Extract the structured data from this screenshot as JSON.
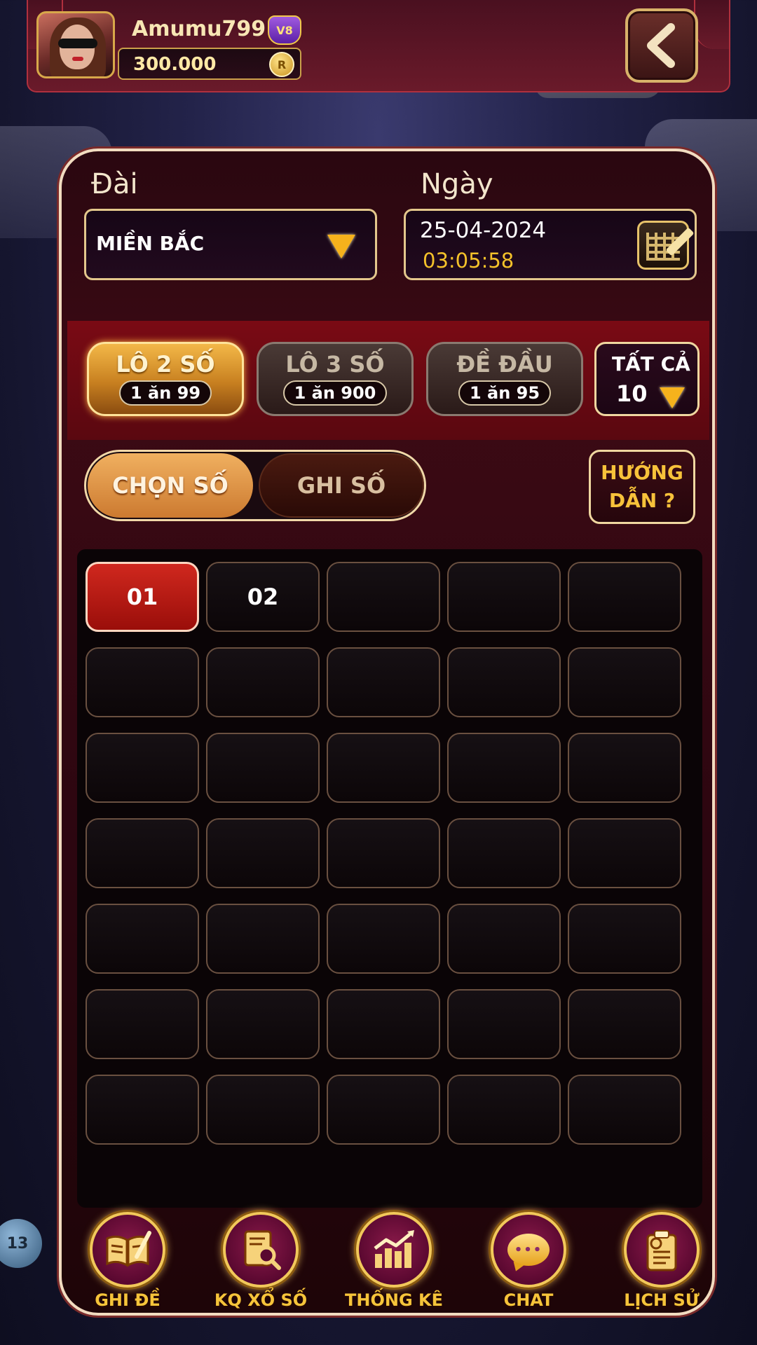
{
  "user": {
    "name": "Amumu799",
    "vip": "V8",
    "balance": "300.000",
    "coin_icon": "R"
  },
  "labels": {
    "station": "Đài",
    "date": "Ngày"
  },
  "station_select": {
    "value": "MIỀN BẮC"
  },
  "date_box": {
    "date": "25-04-2024",
    "time": "03:05:58"
  },
  "bet_types": [
    {
      "name": "LÔ 2 SỐ",
      "rate": "1 ăn 99",
      "active": true
    },
    {
      "name": "LÔ 3 SỐ",
      "rate": "1 ăn 900",
      "active": false
    },
    {
      "name": "ĐỀ ĐẦU",
      "rate": "1 ăn 95",
      "active": false
    }
  ],
  "all_filter": {
    "label": "TẤT CẢ",
    "value": "10"
  },
  "mode_toggle": {
    "choose": "CHỌN SỐ",
    "write": "GHI SỐ",
    "active": "CHỌN SỐ"
  },
  "guide": {
    "line1": "HƯỚNG",
    "line2": "DẪN ?"
  },
  "grid": {
    "rows": 7,
    "cols": 5,
    "cells": [
      "01",
      "02"
    ],
    "selected": "01"
  },
  "bottom_nav": [
    {
      "label": "GHI ĐỀ",
      "icon": "book-pen-icon"
    },
    {
      "label": "KQ XỔ SỐ",
      "icon": "document-search-icon"
    },
    {
      "label": "THỐNG KÊ",
      "icon": "chart-up-icon"
    },
    {
      "label": "CHAT",
      "icon": "chat-bubble-icon"
    },
    {
      "label": "LỊCH SỬ",
      "icon": "history-clipboard-icon"
    }
  ],
  "background": {
    "ball_number": "13"
  },
  "colors": {
    "accent_gold": "#f6c43a",
    "selected_red": "#d0281e",
    "panel_border": "#f2dcc0"
  }
}
